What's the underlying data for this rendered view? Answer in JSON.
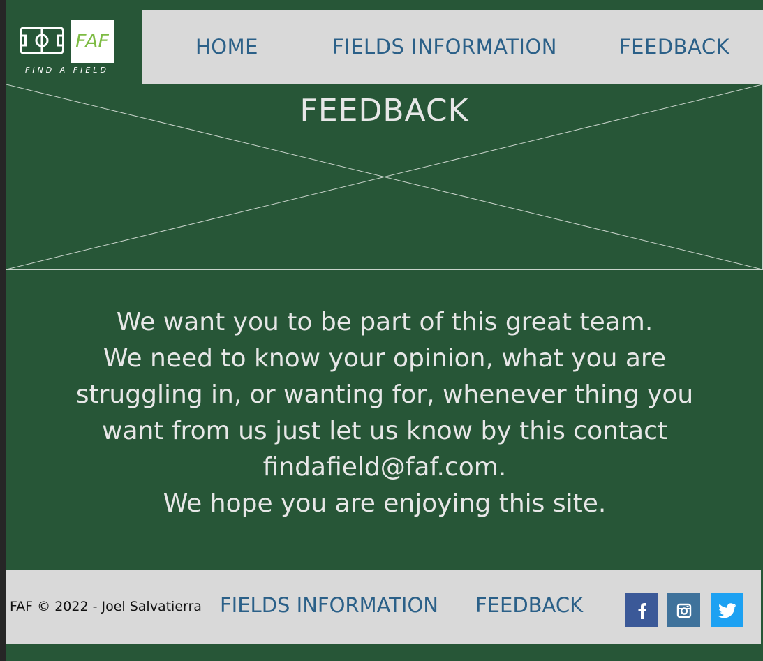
{
  "brand": {
    "logo_text": "FAF",
    "tagline": "FIND A FIELD",
    "accent_color": "#7dbb43"
  },
  "nav": {
    "items": [
      {
        "label": "HOME"
      },
      {
        "label": "FIELDS INFORMATION"
      },
      {
        "label": "FEEDBACK"
      }
    ],
    "link_color": "#2b6088"
  },
  "hero": {
    "title": "FEEDBACK"
  },
  "message": {
    "lines": [
      "We want you to be part of this great team.",
      "We need to know your opinion, what you are struggling in, or wanting for, whenever thing you want from us just let us know by this contact findafield@faf.com.",
      "We hope you are enjoying this site."
    ]
  },
  "footer": {
    "copyright": "FAF © 2022 - Joel Salvatierra",
    "links": [
      {
        "label": "FIELDS INFORMATION"
      },
      {
        "label": "FEEDBACK"
      }
    ],
    "social": [
      {
        "icon": "facebook-icon",
        "color": "#3b5998"
      },
      {
        "icon": "instagram-icon",
        "color": "#3f729b"
      },
      {
        "icon": "twitter-icon",
        "color": "#1da1f2"
      }
    ]
  },
  "colors": {
    "background": "#275637",
    "bar": "#d9d9d9",
    "text_light": "#e7e7e7"
  }
}
